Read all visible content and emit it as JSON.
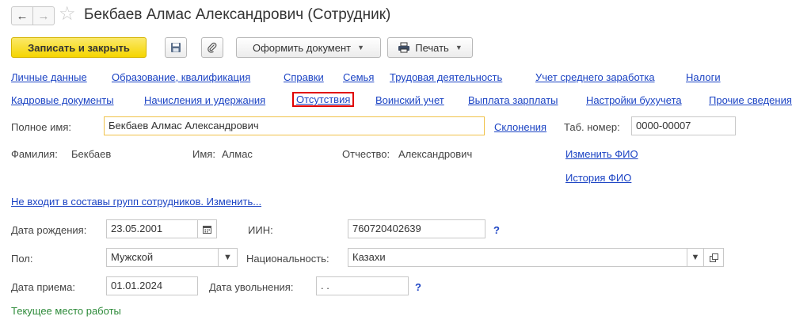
{
  "window": {
    "title": "Бекбаев Алмас Александрович (Сотрудник)"
  },
  "nav": {
    "back": "←",
    "forward": "→",
    "star": "☆"
  },
  "toolbar": {
    "save_close": "Записать и закрыть",
    "oformit": "Оформить документ",
    "print": "Печать"
  },
  "links_row1": [
    "Личные данные",
    "Образование, квалификация",
    "Справки",
    "Семья",
    "Трудовая деятельность",
    "Учет среднего заработка",
    "Налоги"
  ],
  "links_row2": [
    "Кадровые документы",
    "Начисления и удержания",
    "Отсутствия",
    "Воинский учет",
    "Выплата зарплаты",
    "Настройки бухучета",
    "Прочие сведения"
  ],
  "fullname": {
    "label": "Полное имя:",
    "value": "Бекбаев Алмас Александрович",
    "sklon": "Склонения",
    "tab_label": "Таб. номер:",
    "tab_value": "0000-00007"
  },
  "fio": {
    "surname_label": "Фамилия:",
    "surname": "Бекбаев",
    "name_label": "Имя:",
    "name": "Алмас",
    "patronymic_label": "Отчество:",
    "patronymic": "Александрович",
    "change_link": "Изменить ФИО",
    "history_link": "История ФИО"
  },
  "groups_link": "Не входит в составы групп сотрудников. Изменить...",
  "birth": {
    "label": "Дата рождения:",
    "value": "23.05.2001",
    "iin_label": "ИИН:",
    "iin_value": "760720402639",
    "help": "?"
  },
  "gender": {
    "label": "Пол:",
    "value": "Мужской",
    "nat_label": "Национальность:",
    "nat_value": "Казахи"
  },
  "hire": {
    "label": "Дата приема:",
    "value": "01.01.2024",
    "fire_label": "Дата увольнения:",
    "fire_value": " .  .",
    "help": "?"
  },
  "current_job": "Текущее место работы"
}
